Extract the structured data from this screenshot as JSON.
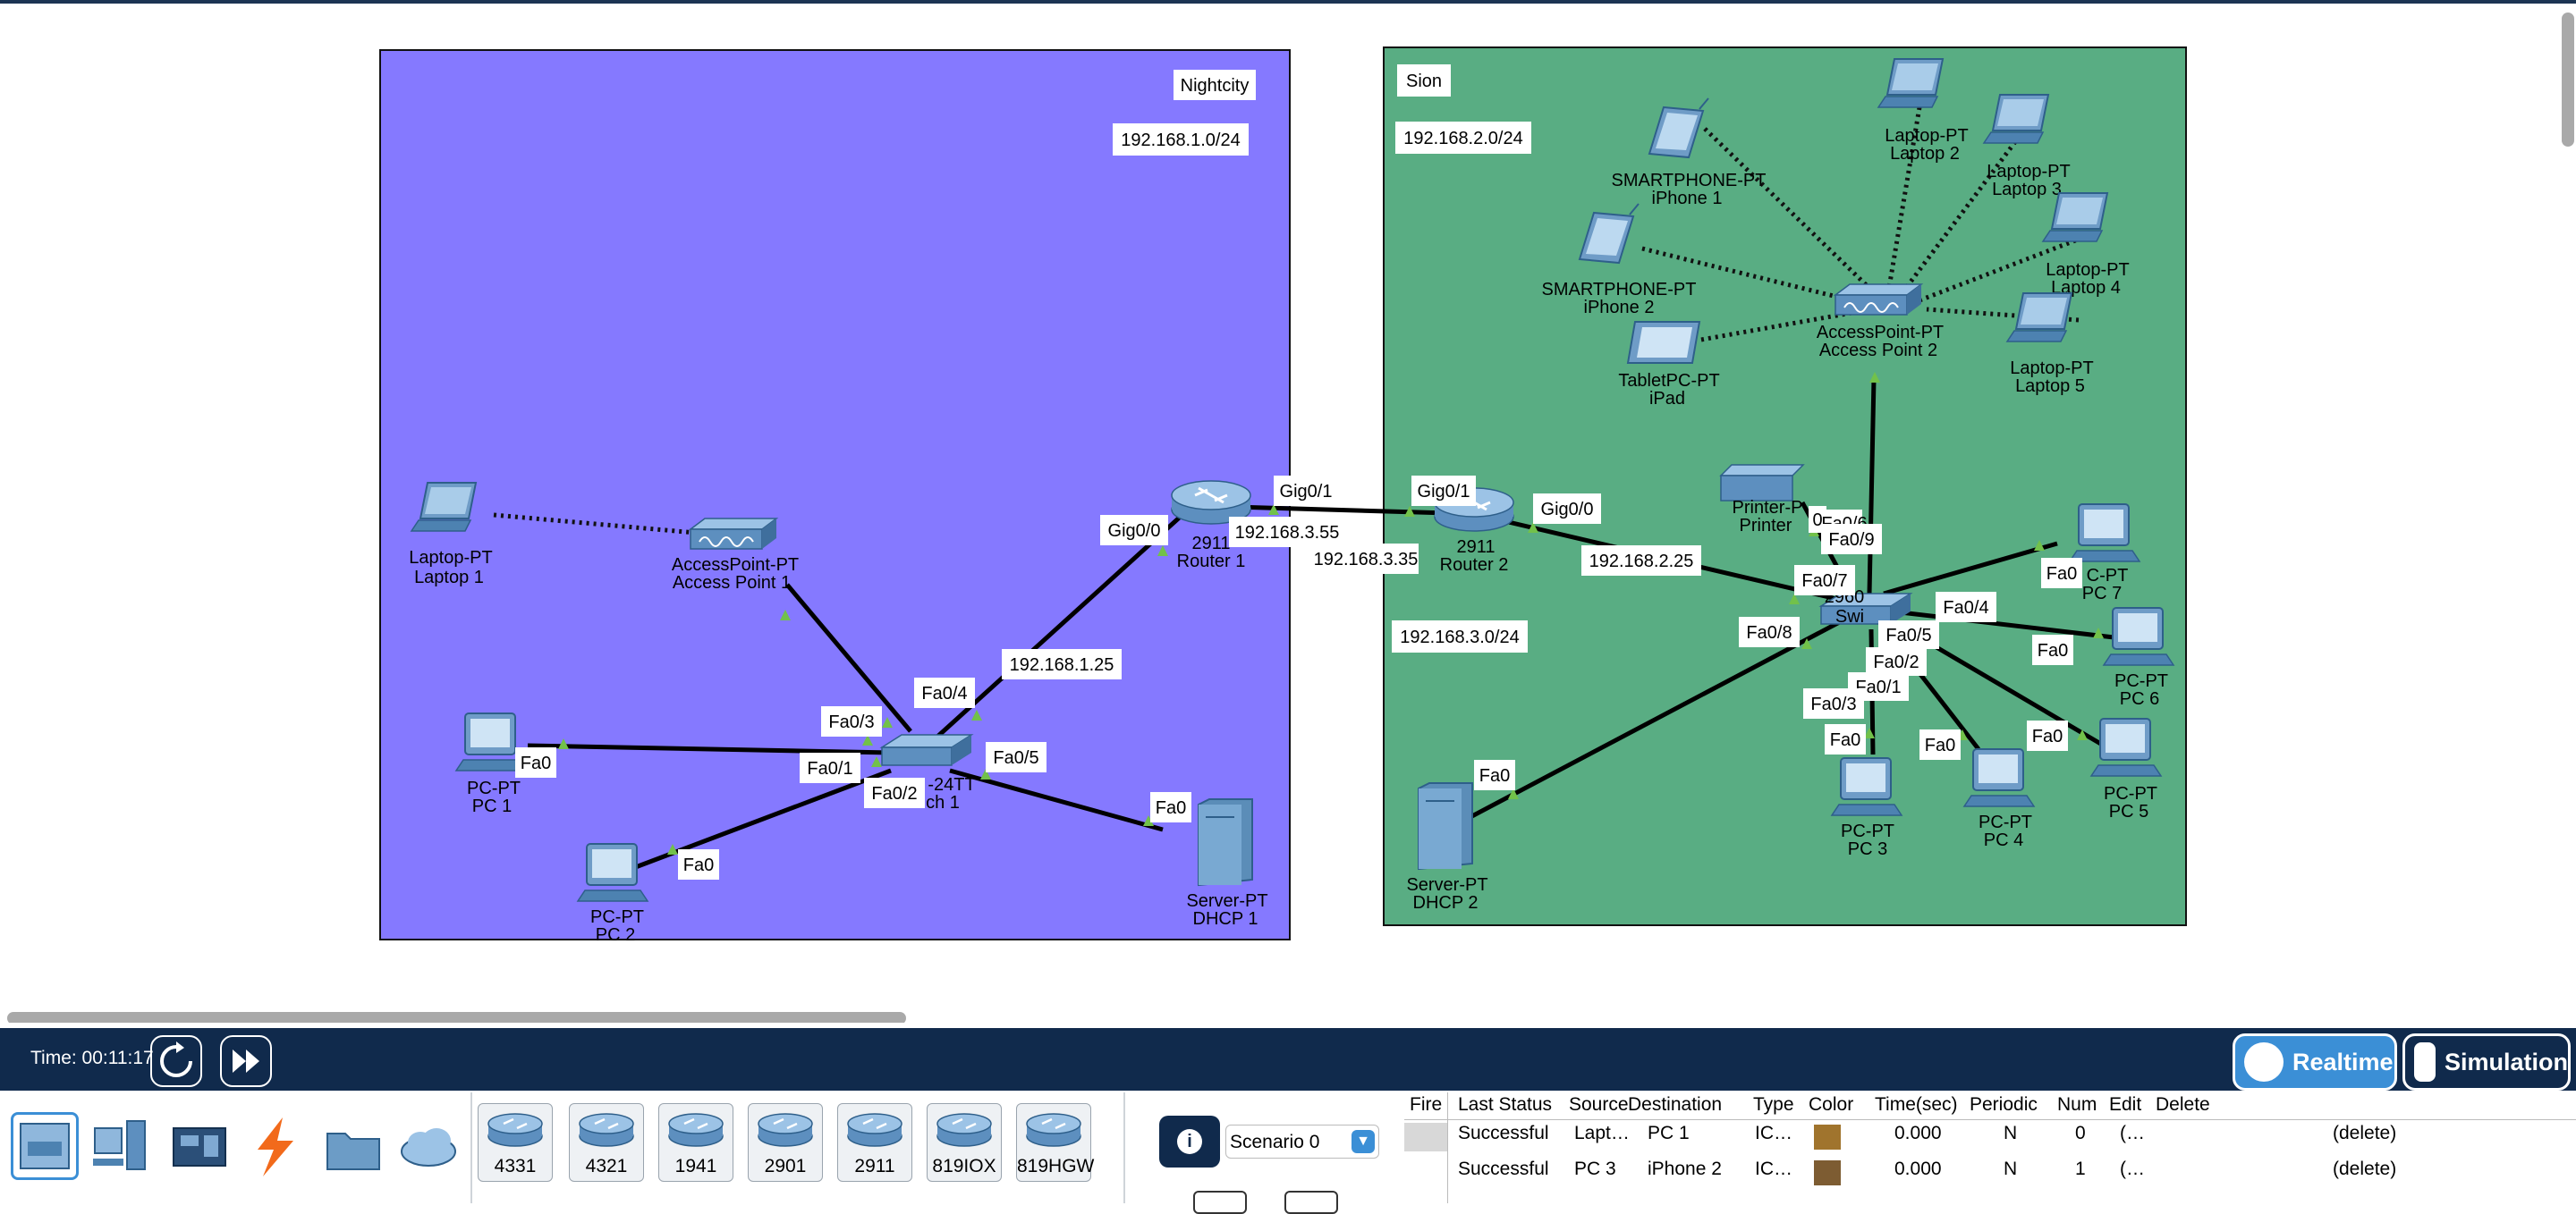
{
  "colors": {
    "nightcity_bg": "#8579ff",
    "sion_bg": "#59ad83",
    "topbar": "#102a4c",
    "realtime_btn": "#3b8fd6",
    "link_green": "#72c14a"
  },
  "areas": {
    "nightcity": {
      "name": "Nightcity",
      "subnet": "192.168.1.0/24"
    },
    "sion": {
      "name": "Sion",
      "subnet1": "192.168.2.0/24",
      "subnet2": "192.168.3.0/24"
    }
  },
  "devices": {
    "laptop1": {
      "model": "Laptop-PT",
      "name": "Laptop 1",
      "icon": "laptop-icon"
    },
    "ap1": {
      "model": "AccessPoint-PT",
      "name": "Access Point 1",
      "icon": "access-point-icon"
    },
    "switch1": {
      "model": "-24TT",
      "name": "ch 1",
      "icon": "switch-icon"
    },
    "router1": {
      "model": "2911",
      "name": "Router 1",
      "icon": "router-icon"
    },
    "pc1": {
      "model": "PC-PT",
      "name": "PC 1",
      "icon": "pc-icon"
    },
    "pc2": {
      "model": "PC-PT",
      "name": "PC 2",
      "icon": "pc-icon"
    },
    "dhcp1": {
      "model": "Server-PT",
      "name": "DHCP 1",
      "icon": "server-icon"
    },
    "router2": {
      "model": "2911",
      "name": "Router 2",
      "icon": "router-icon"
    },
    "iphone1": {
      "model": "SMARTPHONE-PT",
      "name": "iPhone 1",
      "icon": "smartphone-icon"
    },
    "iphone2": {
      "model": "SMARTPHONE-PT",
      "name": "iPhone 2",
      "icon": "smartphone-icon"
    },
    "ipad": {
      "model": "TabletPC-PT",
      "name": "iPad",
      "icon": "tablet-icon"
    },
    "ap2": {
      "model": "AccessPoint-PT",
      "name": "Access Point 2",
      "icon": "access-point-icon"
    },
    "laptop2": {
      "model": "Laptop-PT",
      "name": "Laptop 2",
      "icon": "laptop-icon"
    },
    "laptop3": {
      "model": "Laptop-PT",
      "name": "Laptop 3",
      "icon": "laptop-icon"
    },
    "laptop4": {
      "model": "Laptop-PT",
      "name": "Laptop 4",
      "icon": "laptop-icon"
    },
    "laptop5": {
      "model": "Laptop-PT",
      "name": "Laptop 5",
      "icon": "laptop-icon"
    },
    "printer": {
      "model": "Printer-P",
      "name": "Printer",
      "icon": "printer-icon"
    },
    "switch2": {
      "model": "2960",
      "name": "Swi",
      "icon": "switch-icon"
    },
    "pc3": {
      "model": "PC-PT",
      "name": "PC 3",
      "icon": "pc-icon"
    },
    "pc4": {
      "model": "PC-PT",
      "name": "PC 4",
      "icon": "pc-icon"
    },
    "pc5": {
      "model": "PC-PT",
      "name": "PC 5",
      "icon": "pc-icon"
    },
    "pc6": {
      "model": "PC-PT",
      "name": "PC 6",
      "icon": "pc-icon"
    },
    "pc7": {
      "model": "C-PT",
      "name": "PC 7",
      "icon": "pc-icon"
    },
    "dhcp2": {
      "model": "Server-PT",
      "name": "DHCP 2",
      "icon": "server-icon"
    }
  },
  "ports": {
    "r1_gig00": "Gig0/0",
    "r1_gig01": "Gig0/1",
    "r1_ip": "192.168.3.55",
    "r2_gig01": "Gig0/1",
    "r2_gig00": "Gig0/0",
    "r2_ip": "192.168.3.35",
    "r1_lan_ip": "192.168.1.25",
    "r2_lan_ip": "192.168.2.25",
    "s1_fa04": "Fa0/4",
    "s1_fa03": "Fa0/3",
    "s1_fa01": "Fa0/1",
    "s1_fa02": "Fa0/2",
    "s1_fa05": "Fa0/5",
    "pc1_fa0": "Fa0",
    "pc2_fa0": "Fa0",
    "dhcp1_fa0": "Fa0",
    "printer_fa0": "0",
    "s2_fa06": "Fa0/6",
    "s2_fa09": "Fa0/9",
    "s2_fa07": "Fa0/7",
    "s2_fa08": "Fa0/8",
    "s2_fa04": "Fa0/4",
    "s2_fa05": "Fa0/5",
    "s2_fa02": "Fa0/2",
    "s2_fa01": "Fa0/1",
    "s2_fa03": "Fa0/3",
    "pc7_fa0": "Fa0",
    "pc6_fa0": "Fa0",
    "pc5_fa0": "Fa0",
    "pc4_fa0": "Fa0",
    "pc3_fa0": "Fa0",
    "dhcp2_fa0": "Fa0"
  },
  "bottombar": {
    "time": "Time: 00:11:17",
    "reset_icon": "power-cycle-icon",
    "fastforward_icon": "fast-forward-icon",
    "realtime": "Realtime",
    "simulation": "Simulation"
  },
  "palette": {
    "categories": [
      "network-devices-icon",
      "end-devices-icon",
      "components-icon",
      "connections-icon",
      "miscellaneous-icon",
      "multiuser-icon"
    ],
    "devices": [
      "4331",
      "4321",
      "1941",
      "2901",
      "2911",
      "819IOX",
      "819HGW"
    ]
  },
  "scenario": {
    "label": "Scenario 0"
  },
  "pdu": {
    "headers": [
      "Fire",
      "Last Status",
      "Source",
      "Destination",
      "Type",
      "Color",
      "Time(sec)",
      "Periodic",
      "Num",
      "Edit",
      "Delete"
    ],
    "rows": [
      {
        "status": "Successful",
        "source": "Lapt…",
        "destination": "PC 1",
        "type": "IC…",
        "color": "#a0742d",
        "time": "0.000",
        "periodic": "N",
        "num": "0",
        "edit": "(…",
        "delete": "(delete)"
      },
      {
        "status": "Successful",
        "source": "PC 3",
        "destination": "iPhone 2",
        "type": "IC…",
        "color": "#7d5c32",
        "time": "0.000",
        "periodic": "N",
        "num": "1",
        "edit": "(…",
        "delete": "(delete)"
      }
    ]
  }
}
